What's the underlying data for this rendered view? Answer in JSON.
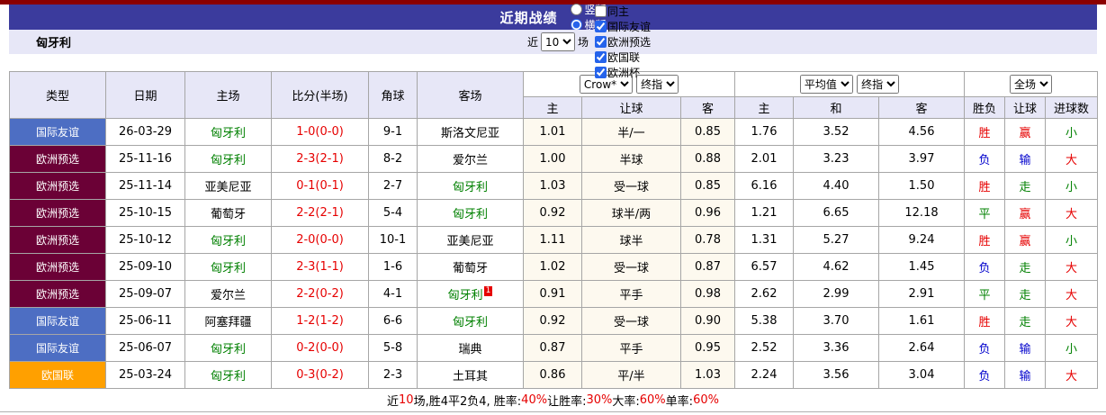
{
  "colors": {
    "accent_bar": "#8b0000",
    "title_bg": "#3b3b9d",
    "panel_bg": "#e7e7f7",
    "border": "#a6a6a6",
    "red": "#e60000",
    "blue": "#0000cc",
    "green": "#008000",
    "odds_bg": "#fdf9ef",
    "type_badges": {
      "国际友谊": "#4d6ec3",
      "欧洲预选": "#6b0136",
      "欧国联": "#ffa000"
    }
  },
  "header": {
    "title": "近期战绩",
    "layout_options": [
      {
        "label": "竖版",
        "selected": false
      },
      {
        "label": "横版",
        "selected": true
      }
    ]
  },
  "filter": {
    "team": "匈牙利",
    "near_label": "近",
    "matches_value": "10",
    "matches_suffix": "场",
    "checkboxes": [
      {
        "label": "同主",
        "checked": false
      },
      {
        "label": "国际友谊",
        "checked": true
      },
      {
        "label": "欧洲预选",
        "checked": true
      },
      {
        "label": "欧国联",
        "checked": true
      },
      {
        "label": "欧洲杯",
        "checked": true
      }
    ]
  },
  "table": {
    "columns": [
      "类型",
      "日期",
      "主场",
      "比分(半场)",
      "角球",
      "客场"
    ],
    "odds_groups": [
      {
        "selects": [
          "Crow*",
          "终指"
        ],
        "sub": [
          "主",
          "让球",
          "客"
        ]
      },
      {
        "selects": [
          "平均值",
          "终指"
        ],
        "sub": [
          "主",
          "和",
          "客"
        ]
      },
      {
        "selects": [
          "全场"
        ],
        "sub": [
          "胜负",
          "让球",
          "进球数"
        ]
      }
    ],
    "rows": [
      {
        "type": "国际友谊",
        "date": "26-03-29",
        "home": "匈牙利",
        "home_green": true,
        "score": "1-0(0-0)",
        "corner": "9-1",
        "away": "斯洛文尼亚",
        "away_green": false,
        "away_badge": "",
        "odds1": [
          "1.01",
          "半/一",
          "0.85"
        ],
        "odds2": [
          "1.76",
          "3.52",
          "4.56"
        ],
        "result": {
          "text": "胜",
          "c": "red"
        },
        "handicap": {
          "text": "赢",
          "c": "red"
        },
        "goals": {
          "text": "小",
          "c": "green"
        }
      },
      {
        "type": "欧洲预选",
        "date": "25-11-16",
        "home": "匈牙利",
        "home_green": true,
        "score": "2-3(2-1)",
        "corner": "8-2",
        "away": "爱尔兰",
        "away_green": false,
        "away_badge": "",
        "odds1": [
          "1.00",
          "半球",
          "0.88"
        ],
        "odds2": [
          "2.01",
          "3.23",
          "3.97"
        ],
        "result": {
          "text": "负",
          "c": "blue"
        },
        "handicap": {
          "text": "输",
          "c": "blue"
        },
        "goals": {
          "text": "大",
          "c": "red"
        }
      },
      {
        "type": "欧洲预选",
        "date": "25-11-14",
        "home": "亚美尼亚",
        "home_green": false,
        "score": "0-1(0-1)",
        "corner": "2-7",
        "away": "匈牙利",
        "away_green": true,
        "away_badge": "",
        "odds1": [
          "1.03",
          "受一球",
          "0.85"
        ],
        "odds2": [
          "6.16",
          "4.40",
          "1.50"
        ],
        "result": {
          "text": "胜",
          "c": "red"
        },
        "handicap": {
          "text": "走",
          "c": "green"
        },
        "goals": {
          "text": "小",
          "c": "green"
        }
      },
      {
        "type": "欧洲预选",
        "date": "25-10-15",
        "home": "葡萄牙",
        "home_green": false,
        "score": "2-2(2-1)",
        "corner": "5-4",
        "away": "匈牙利",
        "away_green": true,
        "away_badge": "",
        "odds1": [
          "0.92",
          "球半/两",
          "0.96"
        ],
        "odds2": [
          "1.21",
          "6.65",
          "12.18"
        ],
        "result": {
          "text": "平",
          "c": "green"
        },
        "handicap": {
          "text": "赢",
          "c": "red"
        },
        "goals": {
          "text": "大",
          "c": "red"
        }
      },
      {
        "type": "欧洲预选",
        "date": "25-10-12",
        "home": "匈牙利",
        "home_green": true,
        "score": "2-0(0-0)",
        "corner": "10-1",
        "away": "亚美尼亚",
        "away_green": false,
        "away_badge": "",
        "odds1": [
          "1.11",
          "球半",
          "0.78"
        ],
        "odds2": [
          "1.31",
          "5.27",
          "9.24"
        ],
        "result": {
          "text": "胜",
          "c": "red"
        },
        "handicap": {
          "text": "赢",
          "c": "red"
        },
        "goals": {
          "text": "小",
          "c": "green"
        }
      },
      {
        "type": "欧洲预选",
        "date": "25-09-10",
        "home": "匈牙利",
        "home_green": true,
        "score": "2-3(1-1)",
        "corner": "1-6",
        "away": "葡萄牙",
        "away_green": false,
        "away_badge": "",
        "odds1": [
          "1.02",
          "受一球",
          "0.87"
        ],
        "odds2": [
          "6.57",
          "4.62",
          "1.45"
        ],
        "result": {
          "text": "负",
          "c": "blue"
        },
        "handicap": {
          "text": "走",
          "c": "green"
        },
        "goals": {
          "text": "大",
          "c": "red"
        }
      },
      {
        "type": "欧洲预选",
        "date": "25-09-07",
        "home": "爱尔兰",
        "home_green": false,
        "score": "2-2(0-2)",
        "corner": "4-1",
        "away": "匈牙利",
        "away_green": true,
        "away_badge": "1",
        "odds1": [
          "0.91",
          "平手",
          "0.98"
        ],
        "odds2": [
          "2.62",
          "2.99",
          "2.91"
        ],
        "result": {
          "text": "平",
          "c": "green"
        },
        "handicap": {
          "text": "走",
          "c": "green"
        },
        "goals": {
          "text": "大",
          "c": "red"
        }
      },
      {
        "type": "国际友谊",
        "date": "25-06-11",
        "home": "阿塞拜疆",
        "home_green": false,
        "score": "1-2(1-2)",
        "corner": "6-6",
        "away": "匈牙利",
        "away_green": true,
        "away_badge": "",
        "odds1": [
          "0.92",
          "受一球",
          "0.90"
        ],
        "odds2": [
          "5.38",
          "3.70",
          "1.61"
        ],
        "result": {
          "text": "胜",
          "c": "red"
        },
        "handicap": {
          "text": "走",
          "c": "green"
        },
        "goals": {
          "text": "大",
          "c": "red"
        }
      },
      {
        "type": "国际友谊",
        "date": "25-06-07",
        "home": "匈牙利",
        "home_green": true,
        "score": "0-2(0-0)",
        "corner": "5-8",
        "away": "瑞典",
        "away_green": false,
        "away_badge": "",
        "odds1": [
          "0.87",
          "平手",
          "0.95"
        ],
        "odds2": [
          "2.52",
          "3.36",
          "2.64"
        ],
        "result": {
          "text": "负",
          "c": "blue"
        },
        "handicap": {
          "text": "输",
          "c": "blue"
        },
        "goals": {
          "text": "小",
          "c": "green"
        }
      },
      {
        "type": "欧国联",
        "date": "25-03-24",
        "home": "匈牙利",
        "home_green": true,
        "score": "0-3(0-2)",
        "corner": "2-3",
        "away": "土耳其",
        "away_green": false,
        "away_badge": "",
        "odds1": [
          "0.86",
          "平/半",
          "1.03"
        ],
        "odds2": [
          "2.24",
          "3.56",
          "3.04"
        ],
        "result": {
          "text": "负",
          "c": "blue"
        },
        "handicap": {
          "text": "输",
          "c": "blue"
        },
        "goals": {
          "text": "大",
          "c": "red"
        }
      }
    ]
  },
  "footer": {
    "segments": [
      {
        "text": "近",
        "c": "black"
      },
      {
        "text": "10",
        "c": "red"
      },
      {
        "text": "场,胜4平2负4, 胜率:",
        "c": "black"
      },
      {
        "text": "40%",
        "c": "red"
      },
      {
        "text": " 让胜率:",
        "c": "black"
      },
      {
        "text": "30%",
        "c": "red"
      },
      {
        "text": " 大率:",
        "c": "black"
      },
      {
        "text": "60%",
        "c": "red"
      },
      {
        "text": " 单率:",
        "c": "black"
      },
      {
        "text": "60%",
        "c": "red"
      }
    ]
  }
}
